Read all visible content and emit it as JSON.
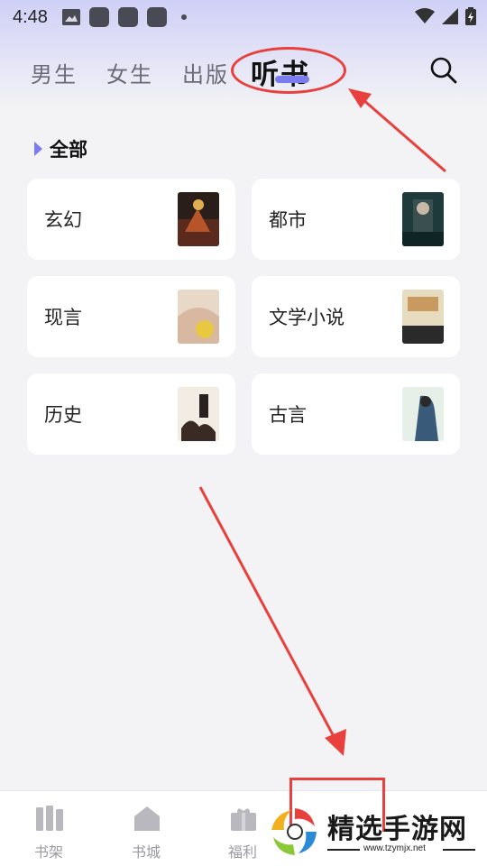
{
  "status_bar": {
    "time": "4:48"
  },
  "tabs": [
    {
      "label": "男生",
      "active": false
    },
    {
      "label": "女生",
      "active": false
    },
    {
      "label": "出版",
      "active": false
    },
    {
      "label": "听书",
      "active": true
    }
  ],
  "section": {
    "title": "全部"
  },
  "categories": [
    {
      "label": "玄幻"
    },
    {
      "label": "都市"
    },
    {
      "label": "现言"
    },
    {
      "label": "文学小说"
    },
    {
      "label": "历史"
    },
    {
      "label": "古言"
    }
  ],
  "bottom_nav": [
    {
      "label": "书架",
      "icon": "bookshelf-icon"
    },
    {
      "label": "书城",
      "icon": "bookstore-icon"
    },
    {
      "label": "福利",
      "icon": "gift-icon"
    }
  ],
  "watermark": {
    "title": "精选手游网",
    "url": "www.tzymjx.net"
  },
  "colors": {
    "accent": "#7b7cf0",
    "annotation": "#e8403c"
  }
}
